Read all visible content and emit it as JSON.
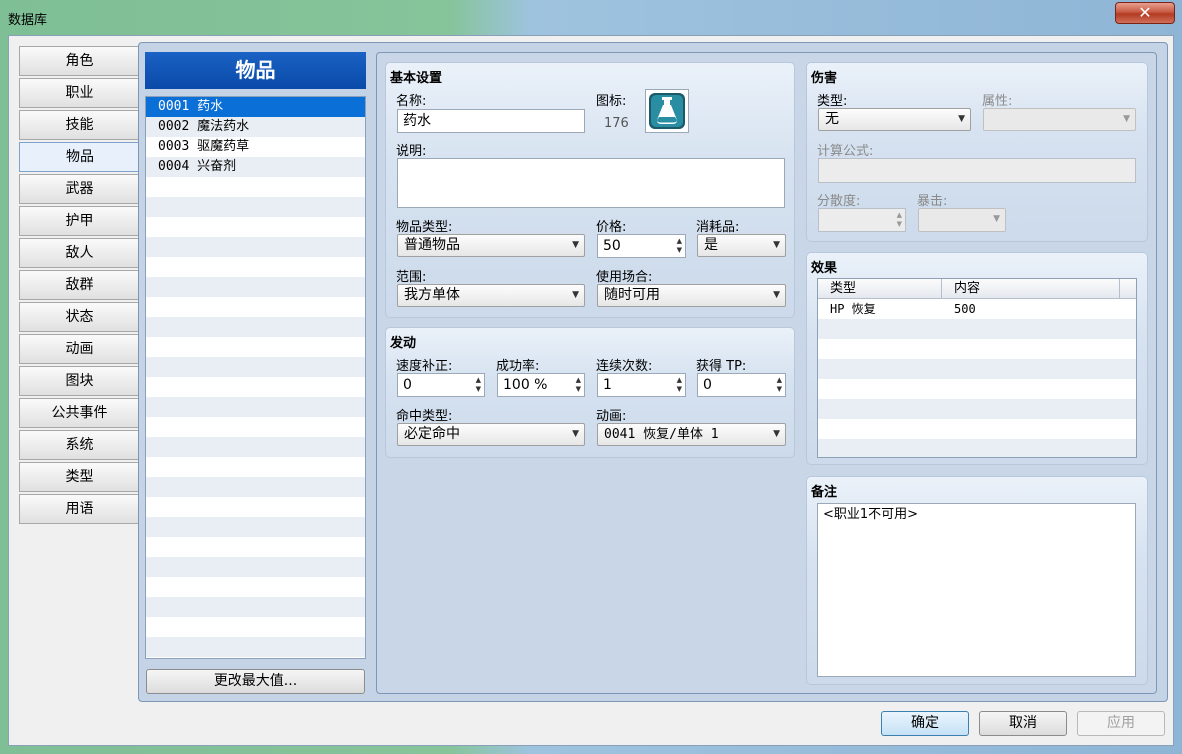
{
  "window": {
    "title": "数据库",
    "close_glyph": "✕"
  },
  "sidebar": {
    "items": [
      "角色",
      "职业",
      "技能",
      "物品",
      "武器",
      "护甲",
      "敌人",
      "敌群",
      "状态",
      "动画",
      "图块",
      "公共事件",
      "系统",
      "类型",
      "用语"
    ],
    "active_index": 3
  },
  "item_list": {
    "header": "物品",
    "items": [
      "0001 药水",
      "0002 魔法药水",
      "0003 驱魔药草",
      "0004 兴奋剂"
    ],
    "selected_index": 0,
    "change_max_button": "更改最大值..."
  },
  "basic": {
    "title": "基本设置",
    "name_label": "名称:",
    "name_value": "药水",
    "icon_label": "图标:",
    "icon_index": "176",
    "icon_name": "potion-icon",
    "desc_label": "说明:",
    "desc_value": "",
    "item_type_label": "物品类型:",
    "item_type_value": "普通物品",
    "price_label": "价格:",
    "price_value": "50",
    "consumable_label": "消耗品:",
    "consumable_value": "是",
    "scope_label": "范围:",
    "scope_value": "我方单体",
    "occasion_label": "使用场合:",
    "occasion_value": "随时可用"
  },
  "invocation": {
    "title": "发动",
    "speed_label": "速度补正:",
    "speed_value": "0",
    "success_label": "成功率:",
    "success_value": "100 %",
    "repeats_label": "连续次数:",
    "repeats_value": "1",
    "tp_label": "获得 TP:",
    "tp_value": "0",
    "hit_type_label": "命中类型:",
    "hit_type_value": "必定命中",
    "animation_label": "动画:",
    "animation_value": "0041 恢复/单体 1"
  },
  "damage": {
    "title": "伤害",
    "type_label": "类型:",
    "type_value": "无",
    "element_label": "属性:",
    "element_value": "",
    "formula_label": "计算公式:",
    "formula_value": "",
    "variance_label": "分散度:",
    "variance_value": "",
    "critical_label": "暴击:",
    "critical_value": ""
  },
  "effects": {
    "title": "效果",
    "columns": [
      "类型",
      "内容"
    ],
    "rows": [
      {
        "type": "HP 恢复",
        "content": "500"
      }
    ]
  },
  "note": {
    "title": "备注",
    "value": "<职业1不可用>"
  },
  "footer": {
    "ok": "确定",
    "cancel": "取消",
    "apply": "应用"
  },
  "colors": {
    "selection": "#0a6fd6",
    "header_blue": "#0a4aa8",
    "panel_bg": "#d6e2f0"
  }
}
